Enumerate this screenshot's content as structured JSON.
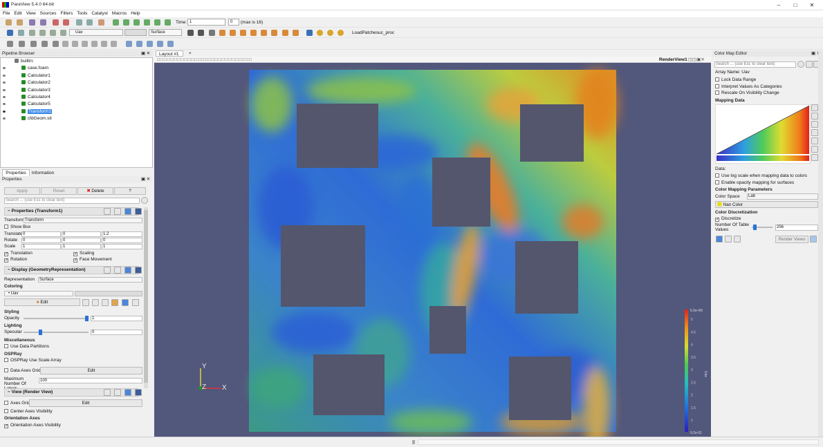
{
  "window": {
    "title": "ParaView 5.4.0 64-bit"
  },
  "menu": [
    "File",
    "Edit",
    "View",
    "Sources",
    "Filters",
    "Tools",
    "Catalyst",
    "Macros",
    "Help"
  ],
  "toolbar": {
    "time_label": "Time:",
    "time_value": "1",
    "time_index": "0",
    "time_max": "(max is 16)",
    "variable": "Uav",
    "representation": "Surface",
    "macro1": "LoadPatches",
    "macro2": "uc_proc"
  },
  "pipeline": {
    "title": "Pipeline Browser",
    "root": "builtin:",
    "items": [
      "case.foam",
      "Calculator1",
      "Calculator2",
      "Calculator3",
      "Calculator4",
      "Calculator5",
      "Transform1",
      "cfdGeom.stl"
    ],
    "selected": "Transform1"
  },
  "props_tabs": [
    "Properties",
    "Information"
  ],
  "properties": {
    "title": "Properties",
    "apply": "Apply",
    "reset": "Reset",
    "delete": "Delete",
    "help": "?",
    "search_placeholder": "Search ... (use Esc to clear text)",
    "sec1": "Properties (Transform1)",
    "transform_label": "Transform",
    "transform_value": "Transform",
    "show_box": "Show Box",
    "translate_label": "Translate",
    "translate": [
      "0",
      "0",
      "1.2"
    ],
    "rotate_label": "Rotate",
    "rotate": [
      "0",
      "0",
      "0"
    ],
    "scale_label": "Scale",
    "scale": [
      "1",
      "1",
      "1"
    ],
    "translation": "Translation",
    "scaling": "Scaling",
    "rotation": "Rotation",
    "face_movement": "Face Movement",
    "sec2": "Display (GeometryRepresentation)",
    "representation_label": "Representation",
    "representation": "Surface",
    "coloring": "Coloring",
    "color_var": "Uav",
    "edit": "Edit",
    "styling": "Styling",
    "opacity_label": "Opacity",
    "opacity": "1",
    "lighting": "Lighting",
    "specular_label": "Specular",
    "specular": "0",
    "misc": "Miscellaneous",
    "use_data_partitions": "Use Data Partitions",
    "ospray": "OSPRay",
    "ospray_use_scale": "OSPRay Use Scale Array",
    "data_axes_grid": "Data Axes Grid",
    "edit2": "Edit",
    "max_labels_label": "Maximum Number Of Labels",
    "max_labels": "100",
    "sec3": "View (Render View)",
    "axes_grid": "Axes Grid",
    "edit3": "Edit",
    "center_axes": "Center Axes Visibility",
    "orientation_axes": "Orientation Axes",
    "orientation_vis": "Orientation Axes Visibility"
  },
  "layout": {
    "tab": "Layout #1",
    "add": "+",
    "view_name": "RenderView1"
  },
  "colorbar": {
    "top": "5.0e+00",
    "ticks": [
      "5",
      "4.5",
      "4",
      "3.5",
      "3",
      "2.5",
      "2",
      "1.5",
      "1"
    ],
    "bottom": "9.2e-01",
    "title": "Uav"
  },
  "axes": {
    "y": "Y",
    "z": "Z",
    "x": "X"
  },
  "cme": {
    "title": "Color Map Editor",
    "search_placeholder": "Search ... (use Esc to clear text)",
    "array_name": "Array Name: Uav",
    "lock_range": "Lock Data Range",
    "interpret": "Interpret Values As Categories",
    "rescale": "Rescale On Visibility Change",
    "mapping_data": "Mapping Data",
    "data_label": "Data:",
    "log_scale": "Use log scale when mapping data to colors",
    "opacity_mapping": "Enable opacity mapping for surfaces",
    "params": "Color Mapping Parameters",
    "color_space_label": "Color Space",
    "color_space": "Lab",
    "nan_color": "Nan Color",
    "discretization": "Color Discretization",
    "discretize": "Discretize",
    "num_table_label": "Number Of Table Values",
    "num_table": "256",
    "render_views": "Render Views"
  },
  "colors": {
    "background": "#52577c",
    "selection": "#3b89e8",
    "obstacle": "#54576e"
  }
}
